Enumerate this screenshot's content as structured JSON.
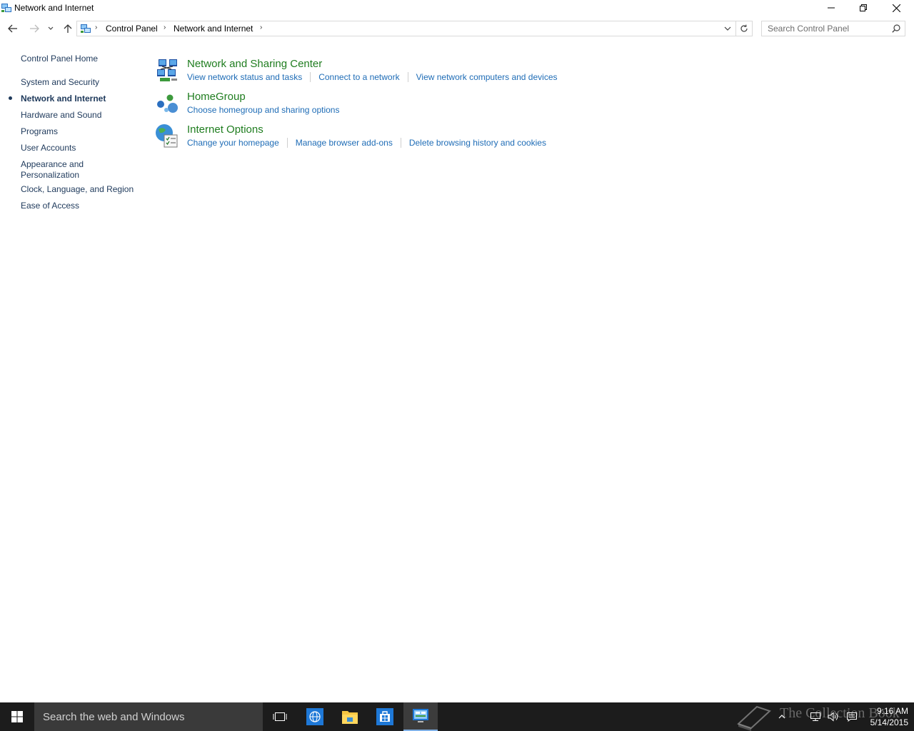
{
  "window": {
    "title": "Network and Internet",
    "icon": "control-panel-icon"
  },
  "titlebar_buttons": {
    "minimize": "minimize-icon",
    "restore": "restore-icon",
    "close": "close-icon"
  },
  "navigation": {
    "back": "back-arrow-icon",
    "forward": "forward-arrow-icon",
    "recent": "chevron-down-icon",
    "up": "up-arrow-icon"
  },
  "address": {
    "crumbs": [
      "Control Panel",
      "Network and Internet"
    ],
    "dropdown": "chevron-down-icon",
    "refresh": "refresh-icon"
  },
  "search": {
    "placeholder": "Search Control Panel",
    "icon": "search-icon"
  },
  "sidebar": {
    "home": "Control Panel Home",
    "items": [
      {
        "label": "System and Security",
        "active": false
      },
      {
        "label": "Network and Internet",
        "active": true
      },
      {
        "label": "Hardware and Sound",
        "active": false
      },
      {
        "label": "Programs",
        "active": false
      },
      {
        "label": "User Accounts",
        "active": false
      },
      {
        "label": "Appearance and Personalization",
        "active": false
      },
      {
        "label": "Clock, Language, and Region",
        "active": false
      },
      {
        "label": "Ease of Access",
        "active": false
      }
    ]
  },
  "categories": [
    {
      "title": "Network and Sharing Center",
      "icon": "network-sharing-icon",
      "links": [
        "View network status and tasks",
        "Connect to a network",
        "View network computers and devices"
      ]
    },
    {
      "title": "HomeGroup",
      "icon": "homegroup-icon",
      "links": [
        "Choose homegroup and sharing options"
      ]
    },
    {
      "title": "Internet Options",
      "icon": "internet-options-icon",
      "links": [
        "Change your homepage",
        "Manage browser add-ons",
        "Delete browsing history and cookies"
      ]
    }
  ],
  "taskbar": {
    "search_placeholder": "Search the web and Windows",
    "apps": [
      "task-view-icon",
      "browser-icon",
      "file-explorer-icon",
      "store-icon",
      "control-panel-icon"
    ],
    "tray": [
      "show-hidden-icons-icon",
      "network-icon",
      "volume-icon",
      "action-center-icon"
    ],
    "time": "9:16 AM",
    "date": "5/14/2015",
    "watermark": "The Collection Book"
  },
  "colors": {
    "link": "#1e6cb6",
    "category_title": "#1f7d1f",
    "sidebar_link": "#1e395b",
    "taskbar": "#1c1c1c"
  }
}
